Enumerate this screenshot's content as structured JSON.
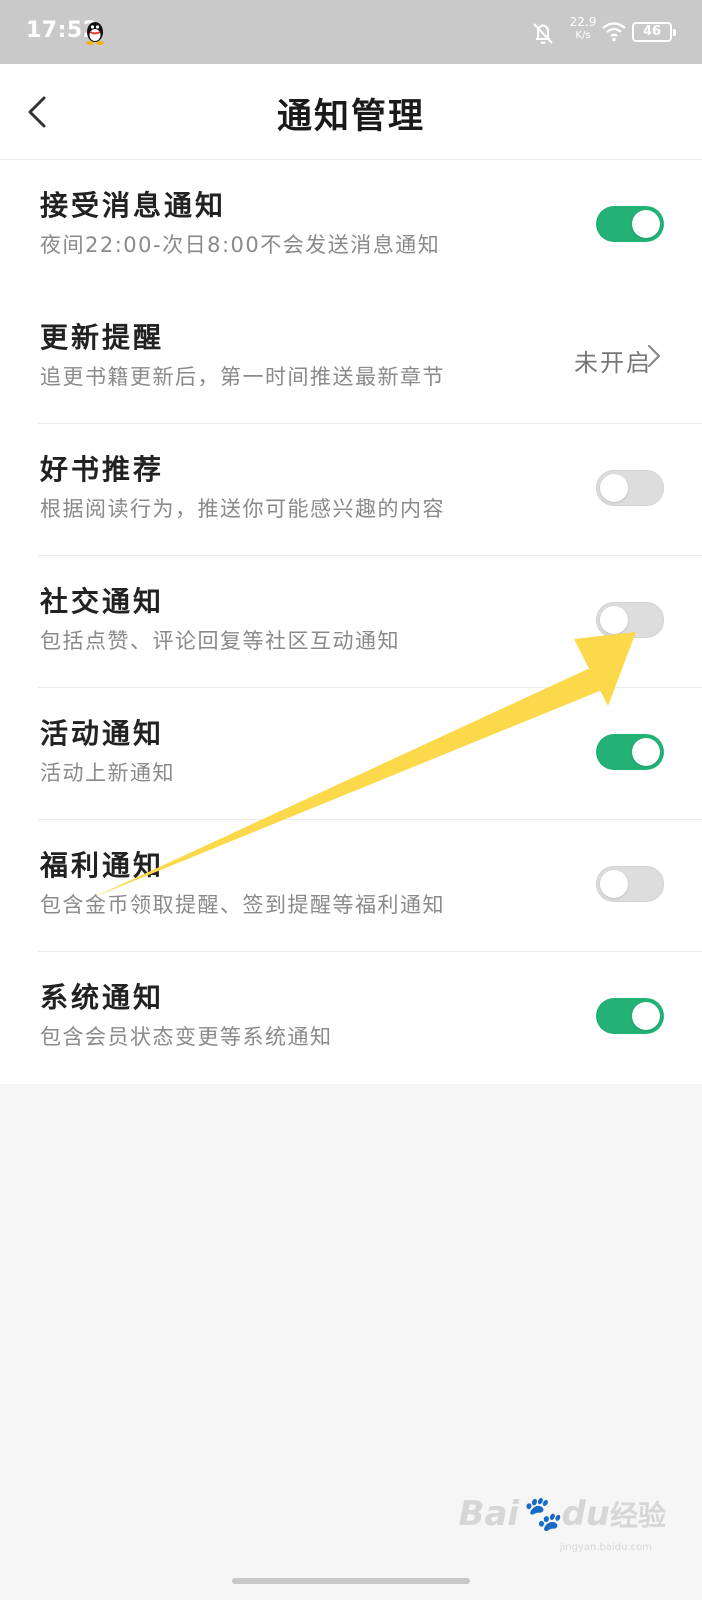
{
  "status_bar": {
    "time": "17:52",
    "net_speed_value": "22.9",
    "net_speed_unit": "K/s",
    "battery": "46",
    "icons": [
      "qq-icon",
      "bell-off-icon",
      "wifi-icon",
      "battery-icon"
    ]
  },
  "header": {
    "title": "通知管理",
    "back_icon": "chevron-left-icon"
  },
  "sections": [
    {
      "items": [
        {
          "label": "接受消息通知",
          "desc": "夜间22:00-次日8:00不会发送消息通知",
          "control": "toggle",
          "on": true
        }
      ]
    },
    {
      "items": [
        {
          "label": "更新提醒",
          "desc": "追更书籍更新后，第一时间推送最新章节",
          "control": "link",
          "value": "未开启"
        },
        {
          "label": "好书推荐",
          "desc": "根据阅读行为，推送你可能感兴趣的内容",
          "control": "toggle",
          "on": false
        },
        {
          "label": "社交通知",
          "desc": "包括点赞、评论回复等社区互动通知",
          "control": "toggle",
          "on": false
        },
        {
          "label": "活动通知",
          "desc": "活动上新通知",
          "control": "toggle",
          "on": true
        },
        {
          "label": "福利通知",
          "desc": "包含金币领取提醒、签到提醒等福利通知",
          "control": "toggle",
          "on": false
        },
        {
          "label": "系统通知",
          "desc": "包含会员状态变更等系统通知",
          "control": "toggle",
          "on": true
        }
      ]
    }
  ],
  "colors": {
    "toggle_on": "#23b275",
    "toggle_off": "#dddddd",
    "annotation_arrow": "#fbd94a",
    "status_bar": "#c9c9c9"
  },
  "watermark": {
    "brand": "Bai",
    "brand_suffix": "du",
    "cn": "经验",
    "url": "jingyan.baidu.com"
  }
}
